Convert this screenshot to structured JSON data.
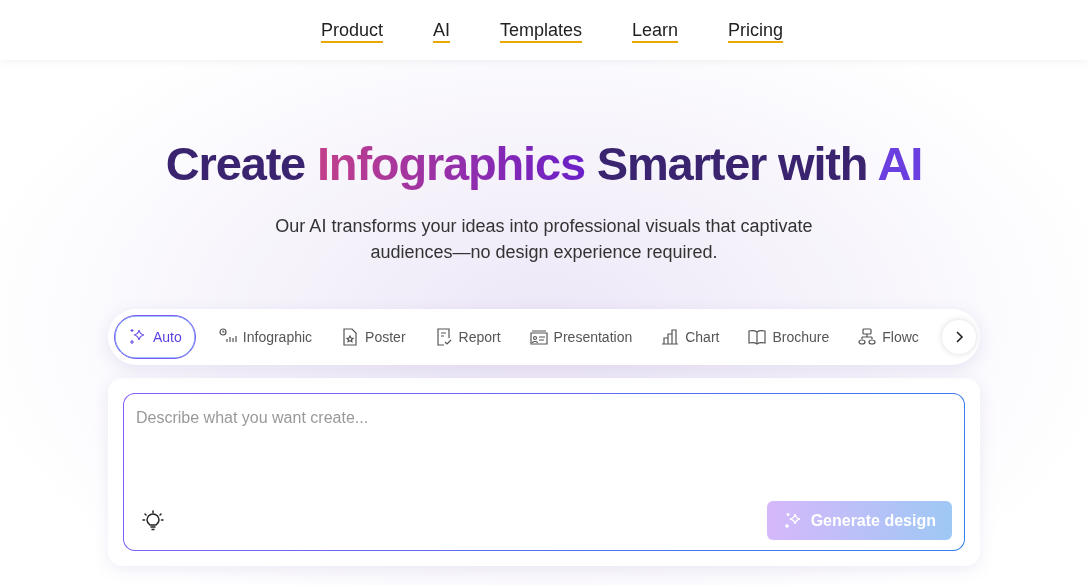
{
  "nav": [
    {
      "label": "Product"
    },
    {
      "label": "AI"
    },
    {
      "label": "Templates"
    },
    {
      "label": "Learn"
    },
    {
      "label": "Pricing"
    }
  ],
  "headline": [
    {
      "text": "Create ",
      "kind": "plain"
    },
    {
      "text": "Infographics",
      "kind": "gradient"
    },
    {
      "text": " Smarter with ",
      "kind": "plain"
    },
    {
      "text": "AI",
      "kind": "accent"
    }
  ],
  "subtitle": "Our AI transforms your ideas into professional visuals that captivate audiences—no design experience required.",
  "tabs": [
    {
      "label": "Auto",
      "kind": "sparkle",
      "selected": true
    },
    {
      "label": "Infographic",
      "kind": "bars",
      "selected": false
    },
    {
      "label": "Poster",
      "kind": "poster",
      "selected": false
    },
    {
      "label": "Report",
      "kind": "report",
      "selected": false
    },
    {
      "label": "Presentation",
      "kind": "presentation",
      "selected": false
    },
    {
      "label": "Chart",
      "kind": "chart",
      "selected": false
    },
    {
      "label": "Brochure",
      "kind": "book",
      "selected": false
    },
    {
      "label": "Flowc",
      "kind": "flow",
      "selected": false
    }
  ],
  "prompt": {
    "placeholder": "Describe what you want create..."
  },
  "generate_button": {
    "label": "Generate design",
    "disabled": true
  }
}
